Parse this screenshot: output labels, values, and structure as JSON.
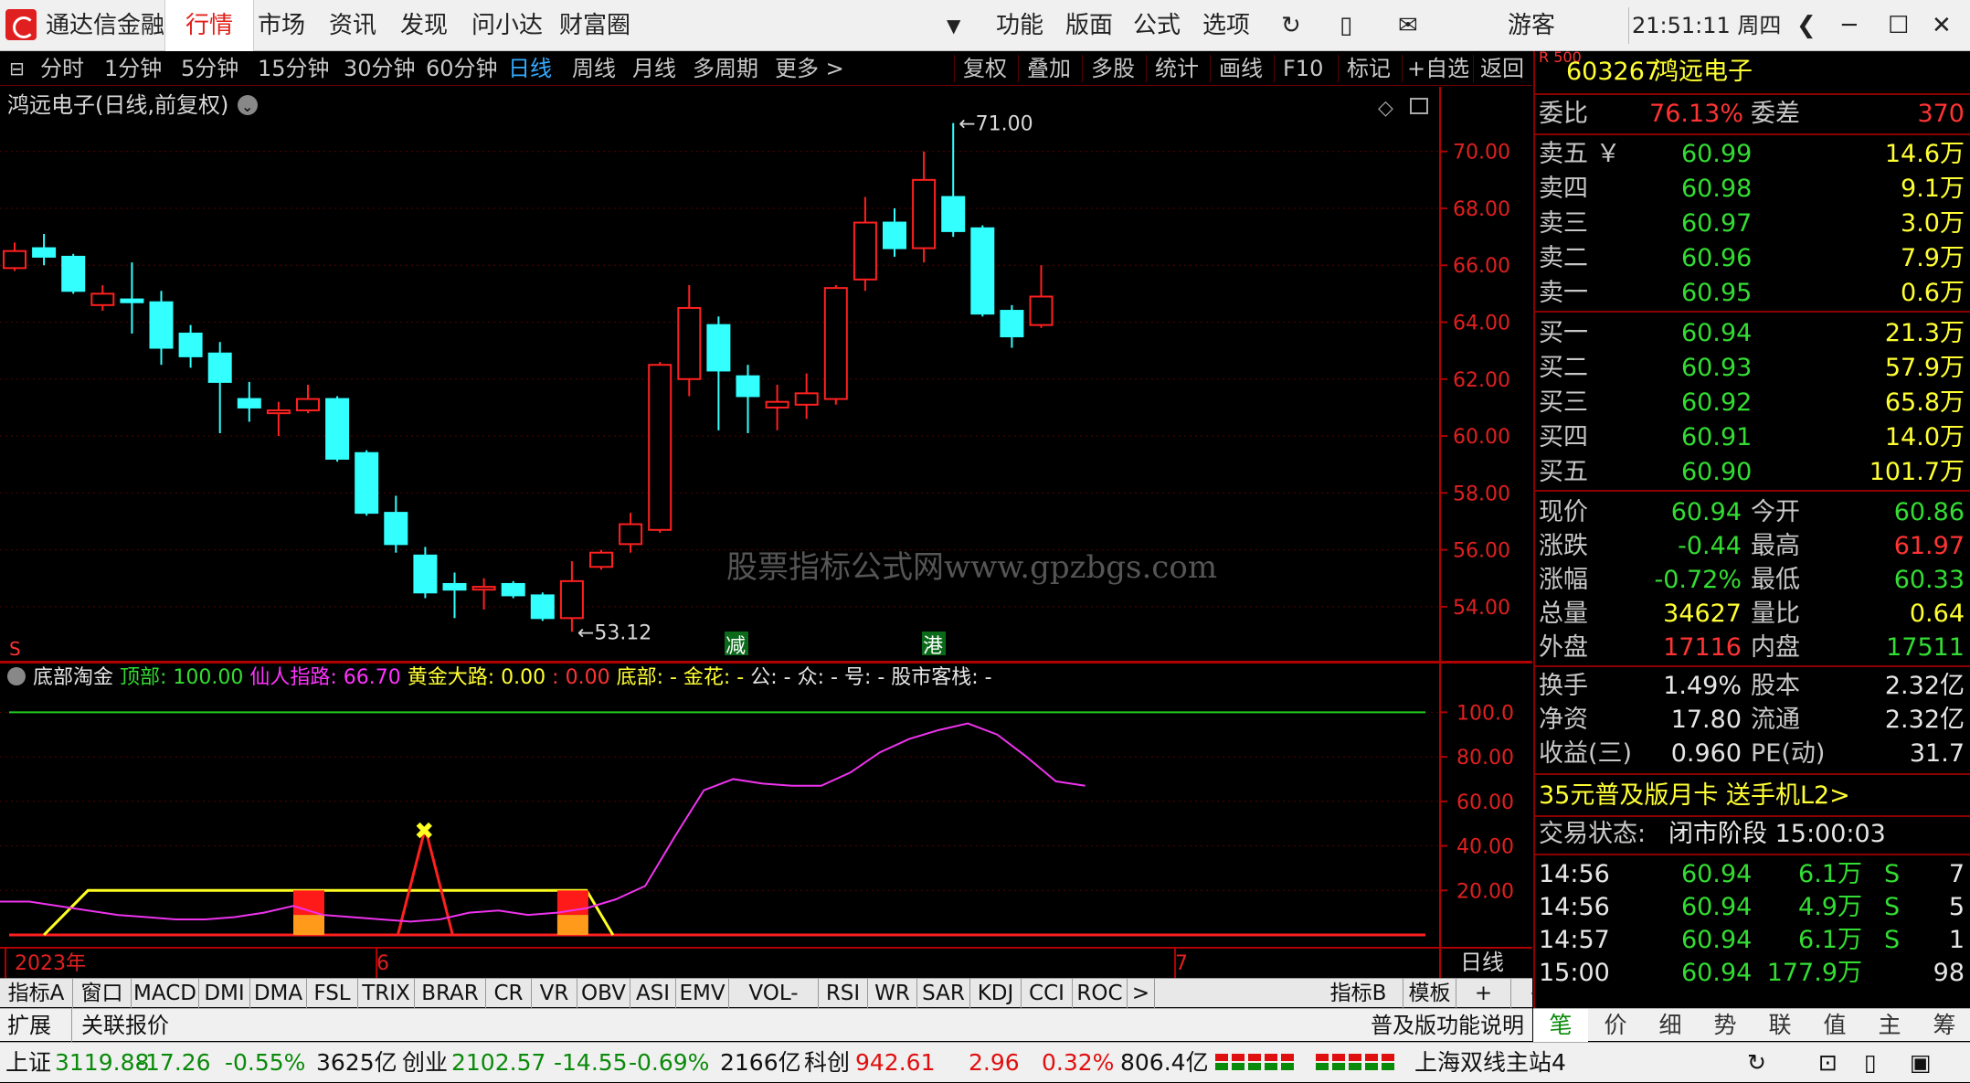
{
  "titlebar": {
    "app_name": "通达信金融终端",
    "nav": [
      "行情",
      "市场",
      "资讯",
      "发现",
      "问小达",
      "财富圈"
    ],
    "menu": [
      "功能",
      "版面",
      "公式",
      "选项"
    ],
    "user": "游客",
    "clock": "21:51:11 周四"
  },
  "periods": [
    "分时",
    "1分钟",
    "5分钟",
    "15分钟",
    "30分钟",
    "60分钟",
    "日线",
    "周线",
    "月线",
    "多周期",
    "更多 >"
  ],
  "tools": [
    "复权",
    "叠加",
    "多股",
    "统计",
    "画线",
    "F10",
    "标记",
    "+自选",
    "返回"
  ],
  "main_chart": {
    "title": "鸿远电子(日线,前复权)",
    "watermark": "股票指标公式网www.gpzbgs.com",
    "high_label": "71.00",
    "low_label": "53.12",
    "markers": [
      "减",
      "港"
    ],
    "s_marker": "S",
    "y_ticks": [
      "70.00",
      "68.00",
      "66.00",
      "64.00",
      "62.00",
      "60.00",
      "58.00",
      "56.00",
      "54.00"
    ],
    "colors": {
      "up": "#ff2020",
      "down": "#33ffff"
    }
  },
  "chart_data": {
    "type": "candlestick",
    "ylim": [
      53,
      71.5
    ],
    "candles": [
      {
        "o": 65.9,
        "c": 66.5,
        "h": 66.8,
        "l": 65.8
      },
      {
        "o": 66.6,
        "c": 66.3,
        "h": 67.1,
        "l": 66.0
      },
      {
        "o": 66.3,
        "c": 65.1,
        "h": 66.4,
        "l": 65.0
      },
      {
        "o": 64.6,
        "c": 65.0,
        "h": 65.3,
        "l": 64.4
      },
      {
        "o": 64.8,
        "c": 64.7,
        "h": 66.1,
        "l": 63.6
      },
      {
        "o": 64.7,
        "c": 63.1,
        "h": 65.1,
        "l": 62.5
      },
      {
        "o": 63.6,
        "c": 62.8,
        "h": 63.9,
        "l": 62.4
      },
      {
        "o": 62.9,
        "c": 61.9,
        "h": 63.3,
        "l": 60.1
      },
      {
        "o": 61.3,
        "c": 61.0,
        "h": 61.9,
        "l": 60.5
      },
      {
        "o": 60.8,
        "c": 60.9,
        "h": 61.2,
        "l": 60.0
      },
      {
        "o": 60.9,
        "c": 61.3,
        "h": 61.8,
        "l": 60.8
      },
      {
        "o": 61.3,
        "c": 59.2,
        "h": 61.4,
        "l": 59.1
      },
      {
        "o": 59.4,
        "c": 57.3,
        "h": 59.5,
        "l": 57.2
      },
      {
        "o": 57.3,
        "c": 56.2,
        "h": 57.9,
        "l": 55.9
      },
      {
        "o": 55.8,
        "c": 54.5,
        "h": 56.1,
        "l": 54.3
      },
      {
        "o": 54.8,
        "c": 54.6,
        "h": 55.2,
        "l": 53.6
      },
      {
        "o": 54.6,
        "c": 54.7,
        "h": 55.0,
        "l": 53.9
      },
      {
        "o": 54.8,
        "c": 54.4,
        "h": 54.9,
        "l": 54.3
      },
      {
        "o": 54.4,
        "c": 53.6,
        "h": 54.5,
        "l": 53.5
      },
      {
        "o": 53.6,
        "c": 54.9,
        "h": 55.6,
        "l": 53.12
      },
      {
        "o": 55.4,
        "c": 55.9,
        "h": 56.0,
        "l": 55.3
      },
      {
        "o": 56.2,
        "c": 56.9,
        "h": 57.3,
        "l": 55.9
      },
      {
        "o": 56.7,
        "c": 62.5,
        "h": 62.6,
        "l": 56.6
      },
      {
        "o": 62.0,
        "c": 64.5,
        "h": 65.3,
        "l": 61.4
      },
      {
        "o": 63.9,
        "c": 62.3,
        "h": 64.2,
        "l": 60.2
      },
      {
        "o": 62.1,
        "c": 61.4,
        "h": 62.5,
        "l": 60.1
      },
      {
        "o": 61.0,
        "c": 61.2,
        "h": 61.8,
        "l": 60.2
      },
      {
        "o": 61.1,
        "c": 61.5,
        "h": 62.2,
        "l": 60.6
      },
      {
        "o": 61.3,
        "c": 65.2,
        "h": 65.3,
        "l": 61.1
      },
      {
        "o": 65.5,
        "c": 67.5,
        "h": 68.4,
        "l": 65.1
      },
      {
        "o": 67.5,
        "c": 66.6,
        "h": 68.0,
        "l": 66.3
      },
      {
        "o": 66.6,
        "c": 69.0,
        "h": 70.0,
        "l": 66.1
      },
      {
        "o": 68.4,
        "c": 67.2,
        "h": 71.0,
        "l": 67.0
      },
      {
        "o": 67.3,
        "c": 64.3,
        "h": 67.4,
        "l": 64.2
      },
      {
        "o": 64.4,
        "c": 63.5,
        "h": 64.6,
        "l": 63.1
      },
      {
        "o": 63.9,
        "c": 64.9,
        "h": 66.0,
        "l": 63.8
      }
    ],
    "indicator": {
      "title": "底部淘金",
      "ylim": [
        0,
        110
      ],
      "y_ticks": [
        "100.0",
        "80.00",
        "60.00",
        "40.00",
        "20.00"
      ],
      "magenta_line": [
        15,
        15,
        13,
        11,
        9,
        8,
        7,
        7,
        8,
        10,
        13,
        9,
        8,
        7,
        6,
        7,
        10,
        11,
        9,
        10,
        12,
        16,
        22,
        44,
        65,
        70,
        68,
        67,
        67,
        73,
        82,
        88,
        92,
        95,
        90,
        80,
        69,
        67
      ],
      "green_level": 100,
      "red_spikes": [
        {
          "at": 14,
          "peak": 48
        }
      ],
      "red_bars_at": [
        10,
        19
      ]
    }
  },
  "indicator_header": {
    "name": "底部淘金",
    "items": [
      {
        "label": "顶部: 100.00",
        "color": "#33dd33"
      },
      {
        "label": "仙人指路: 66.70",
        "color": "#ff33ff"
      },
      {
        "label": "黄金大路: 0.00",
        "color": "#ffff33"
      },
      {
        "label": ": 0.00",
        "color": "#ff3333"
      },
      {
        "label": "底部: -",
        "color": "#ffff33"
      },
      {
        "label": "金花: -",
        "color": "#ffff33"
      },
      {
        "label": "公: -",
        "color": "#e6e6e6"
      },
      {
        "label": "众: -",
        "color": "#e6e6e6"
      },
      {
        "label": "号: -",
        "color": "#e6e6e6"
      },
      {
        "label": "股市客栈: -",
        "color": "#e6e6e6"
      }
    ]
  },
  "x_axis": {
    "labels": [
      "2023年",
      "6",
      "7"
    ],
    "period": "日线"
  },
  "indicator_tabs": [
    "指标A",
    "窗口",
    "MACD",
    "DMI",
    "DMA",
    "FSL",
    "TRIX",
    "BRAR",
    "CR",
    "VR",
    "OBV",
    "ASI",
    "EMV",
    "VOL-TDX",
    "RSI",
    "WR",
    "SAR",
    "KDJ",
    "CCI",
    "ROC",
    ">",
    "指标B",
    "模板",
    "+",
    "−"
  ],
  "ext_tabs": [
    "扩展",
    "关联报价"
  ],
  "ext_right": "普及版功能说明",
  "quote": {
    "code": "603267",
    "name": "鸿远电子",
    "badge": "R 500",
    "weibi_label": "委比",
    "weibi": "76.13%",
    "weicha_label": "委差",
    "weicha": "370",
    "asks": [
      {
        "label": "卖五 ￥",
        "price": "60.99",
        "vol": "14.6万"
      },
      {
        "label": "卖四",
        "price": "60.98",
        "vol": "9.1万"
      },
      {
        "label": "卖三",
        "price": "60.97",
        "vol": "3.0万"
      },
      {
        "label": "卖二",
        "price": "60.96",
        "vol": "7.9万"
      },
      {
        "label": "卖一",
        "price": "60.95",
        "vol": "0.6万"
      }
    ],
    "bids": [
      {
        "label": "买一",
        "price": "60.94",
        "vol": "21.3万"
      },
      {
        "label": "买二",
        "price": "60.93",
        "vol": "57.9万"
      },
      {
        "label": "买三",
        "price": "60.92",
        "vol": "65.8万"
      },
      {
        "label": "买四",
        "price": "60.91",
        "vol": "14.0万"
      },
      {
        "label": "买五",
        "price": "60.90",
        "vol": "101.7万"
      }
    ],
    "stats1": [
      {
        "l1": "现价",
        "v1": "60.94",
        "c1": "green",
        "l2": "今开",
        "v2": "60.86",
        "c2": "green"
      },
      {
        "l1": "涨跌",
        "v1": "-0.44",
        "c1": "green",
        "l2": "最高",
        "v2": "61.97",
        "c2": "red"
      },
      {
        "l1": "涨幅",
        "v1": "-0.72%",
        "c1": "green",
        "l2": "最低",
        "v2": "60.33",
        "c2": "green"
      },
      {
        "l1": "总量",
        "v1": "34627",
        "c1": "yellow",
        "l2": "量比",
        "v2": "0.64",
        "c2": "yellow"
      },
      {
        "l1": "外盘",
        "v1": "17116",
        "c1": "red",
        "l2": "内盘",
        "v2": "17511",
        "c2": "green"
      }
    ],
    "stats2": [
      {
        "l1": "换手",
        "v1": "1.49%",
        "l2": "股本",
        "v2": "2.32亿"
      },
      {
        "l1": "净资",
        "v1": "17.80",
        "l2": "流通",
        "v2": "2.32亿"
      },
      {
        "l1": "收益(三)",
        "v1": "0.960",
        "l2": "PE(动)",
        "v2": "31.7"
      }
    ],
    "promo": "35元普及版月卡 送手机L2>",
    "trade_status_label": "交易状态:",
    "trade_status": "闭市阶段 15:00:03",
    "ticks": [
      {
        "time": "14:56",
        "price": "60.94",
        "vol": "6.1万",
        "side": "S",
        "n": "7"
      },
      {
        "time": "14:56",
        "price": "60.94",
        "vol": "4.9万",
        "side": "S",
        "n": "5"
      },
      {
        "time": "14:57",
        "price": "60.94",
        "vol": "6.1万",
        "side": "S",
        "n": "1"
      },
      {
        "time": "15:00",
        "price": "60.94",
        "vol": "177.9万",
        "side": "",
        "n": "98"
      }
    ]
  },
  "rp_tabs": [
    "笔",
    "价",
    "细",
    "势",
    "联",
    "值",
    "主",
    "筹"
  ],
  "status": {
    "sh_label": "上证",
    "sh_val": "3119.88",
    "sh_chg": "-17.26",
    "sh_pct": "-0.55%",
    "sh_amt": "3625亿",
    "cy_label": "创业",
    "cy_val": "2102.57",
    "cy_chg": "-14.55",
    "cy_pct": "-0.69%",
    "cy_amt": "2166亿",
    "kc_label": "科创",
    "kc_val": "942.61",
    "kc_chg": "2.96",
    "kc_pct": "0.32%",
    "kc_amt": "806.4亿",
    "server": "上海双线主站4"
  }
}
